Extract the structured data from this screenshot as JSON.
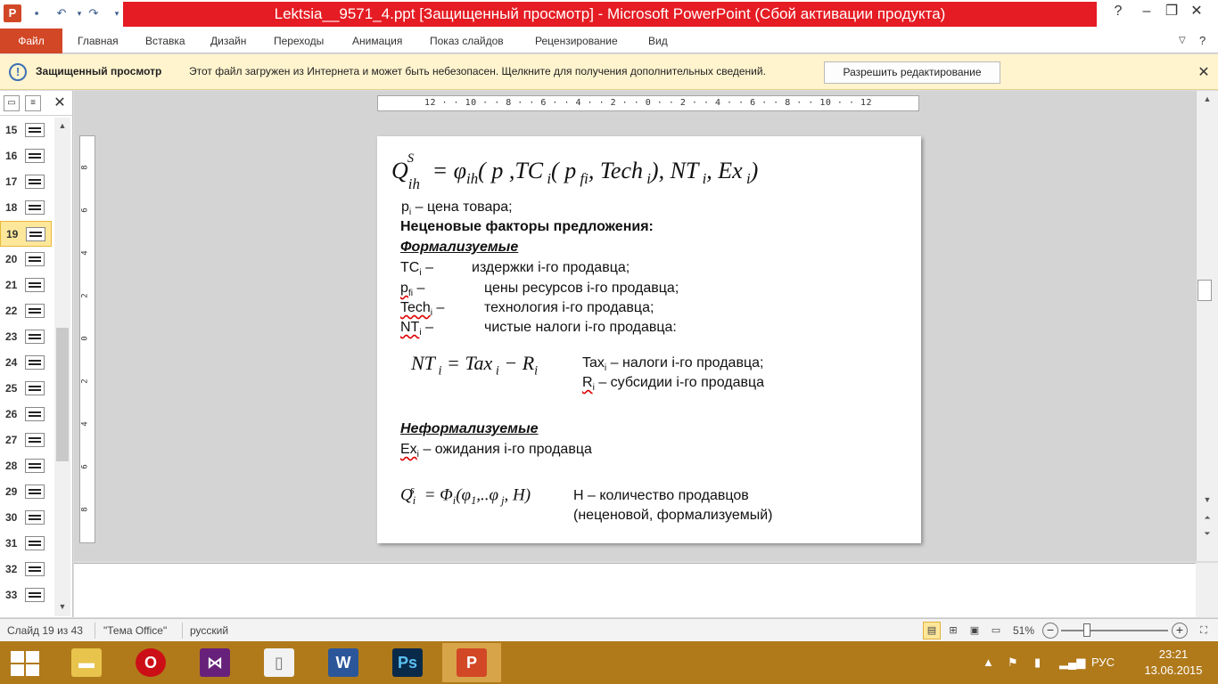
{
  "window": {
    "title": "Lektsia__9571_4.ppt [Защищенный просмотр] - Microsoft PowerPoint (Сбой активации продукта)",
    "app_icon_letter": "P",
    "help_icon": "?"
  },
  "ribbon": {
    "file": "Файл",
    "tabs": [
      "Главная",
      "Вставка",
      "Дизайн",
      "Переходы",
      "Анимация",
      "Показ слайдов",
      "Рецензирование",
      "Вид"
    ]
  },
  "protected_view": {
    "title": "Защищенный просмотр",
    "message": "Этот файл загружен из Интернета и может быть небезопасен. Щелкните для получения дополнительных сведений.",
    "button": "Разрешить редактирование"
  },
  "thumbnails": {
    "numbers": [
      "15",
      "16",
      "17",
      "18",
      "19",
      "20",
      "21",
      "22",
      "23",
      "24",
      "25",
      "26",
      "27",
      "28",
      "29",
      "30",
      "31",
      "32",
      "33"
    ],
    "selected": "19"
  },
  "ruler": {
    "horizontal": "12 · · 10 · · 8 · · 6 · · 4 · · 2 · · 0 · · 2 · · 4 · · 6 · · 8 · · 10 · · 12",
    "vertical": [
      "8",
      "6",
      "4",
      "2",
      "0",
      "2",
      "4",
      "6",
      "8"
    ]
  },
  "slide": {
    "line_price": "– цена товара;",
    "heading": "Неценовые факторы предложения:",
    "formal_heading": "Формализуемые",
    "tc_desc": "издержки i-го продавца;",
    "pf_desc": "цены ресурсов i-го продавца;",
    "tech_desc": "технология i-го продавца;",
    "nt_desc": "чистые налоги  i-го продавца:",
    "tax_desc": "– налоги i-го продавца;",
    "r_desc": "– субсидии i-го продавца",
    "informal_heading": "Неформализуемые",
    "ex_desc": "– ожидания i-го продавца",
    "h_desc_1": "H – количество продавцов",
    "h_desc_2": "(неценовой, формализуемый)"
  },
  "status": {
    "slide_info": "Слайд 19 из 43",
    "theme": "\"Тема Office\"",
    "language": "русский",
    "zoom": "51%"
  },
  "taskbar": {
    "tray_lang": "РУС",
    "time": "23:21",
    "date": "13.06.2015"
  },
  "colors": {
    "accent": "#d24726",
    "title_red": "#e51c23",
    "taskbar": "#b07a1b",
    "protected_bar": "#fff4ce"
  }
}
